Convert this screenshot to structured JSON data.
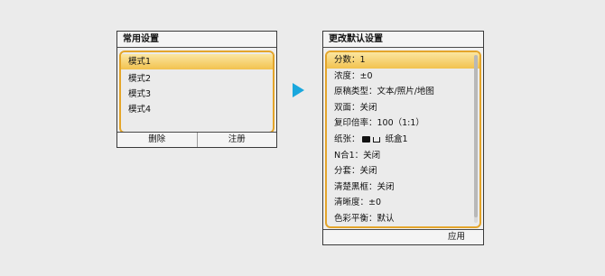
{
  "left_panel": {
    "title": "常用设置",
    "items": [
      "模式1",
      "模式2",
      "模式3",
      "模式4"
    ],
    "buttons": {
      "delete": "删除",
      "register": "注册"
    }
  },
  "right_panel": {
    "title": "更改默认设置",
    "items": [
      "分数：1",
      "浓度：±0",
      "原稿类型：文本/照片/地图",
      "双面：关闭",
      "复印倍率：100（1:1）",
      "纸张：",
      "N合1：关闭",
      "分套：关闭",
      "清楚黑框：关闭",
      "清晰度：±0",
      "色彩平衡：默认"
    ],
    "paper_tray_label": "纸盒1",
    "buttons": {
      "apply": "应用"
    }
  },
  "colors": {
    "highlight_border": "#e4a52a",
    "selected_fill": "#f2c24f",
    "arrow": "#19a7dd"
  }
}
